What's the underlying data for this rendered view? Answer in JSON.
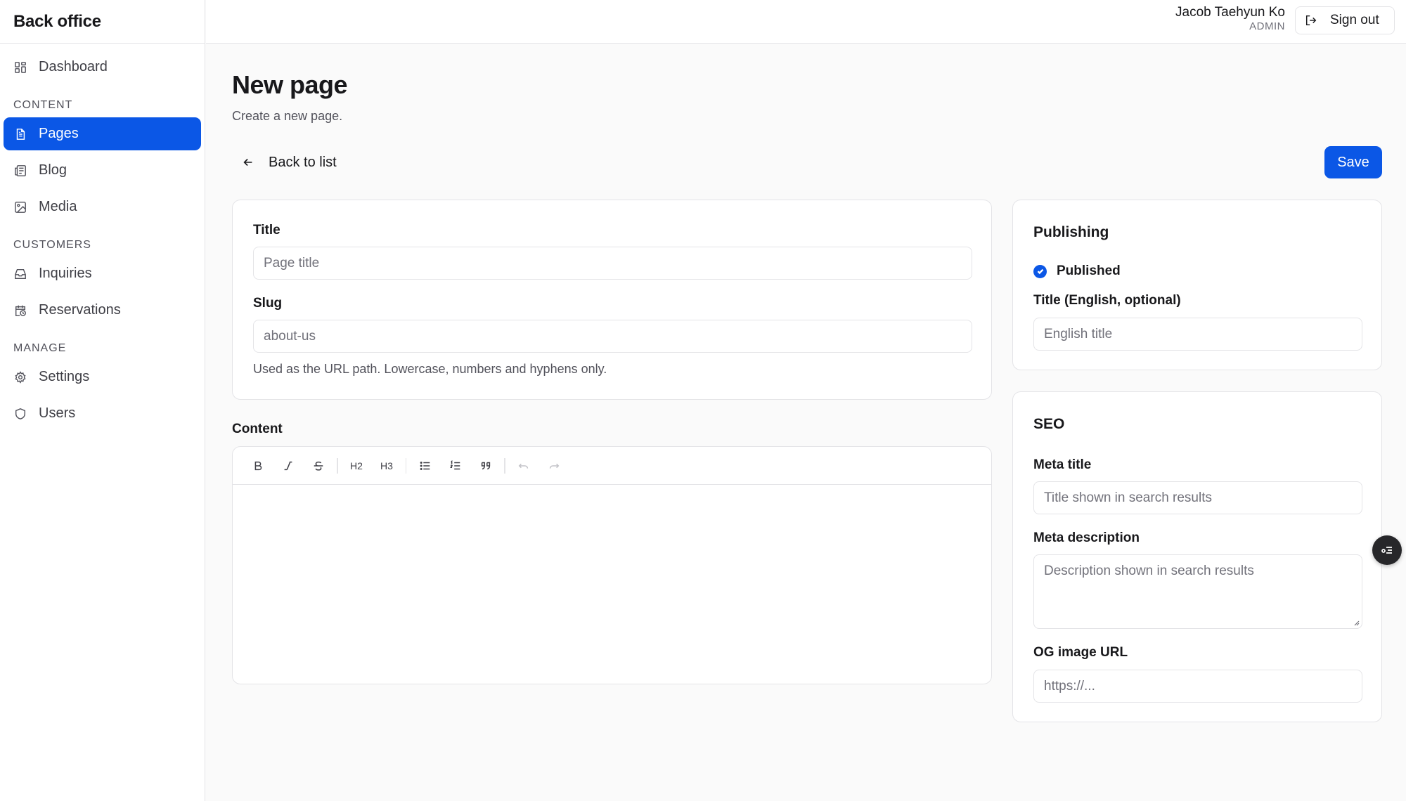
{
  "app": {
    "brand": "Back office"
  },
  "sidebar": {
    "dashboard": "Dashboard",
    "sections": {
      "content": "CONTENT",
      "customers": "CUSTOMERS",
      "manage": "MANAGE"
    },
    "items": {
      "pages": "Pages",
      "blog": "Blog",
      "media": "Media",
      "inquiries": "Inquiries",
      "reservations": "Reservations",
      "settings": "Settings",
      "users": "Users"
    },
    "active": "pages"
  },
  "header": {
    "user_name": "Jacob Taehyun Ko",
    "user_role": "ADMIN",
    "signout_label": "Sign out"
  },
  "page": {
    "title": "New page",
    "subtitle": "Create a new page.",
    "back_label": "Back to list",
    "save_label": "Save"
  },
  "form": {
    "title_label": "Title",
    "title_placeholder": "Page title",
    "slug_label": "Slug",
    "slug_value": "about-us",
    "slug_hint": "Used as the URL path. Lowercase, numbers and hyphens only.",
    "content_label": "Content",
    "toolbar": {
      "h2": "H2",
      "h3": "H3"
    }
  },
  "publishing": {
    "heading": "Publishing",
    "published_label": "Published",
    "published_checked": true,
    "title_en_label": "Title (English, optional)",
    "title_en_placeholder": "English title"
  },
  "seo": {
    "heading": "SEO",
    "meta_title_label": "Meta title",
    "meta_title_placeholder": "Title shown in search results",
    "meta_desc_label": "Meta description",
    "meta_desc_placeholder": "Description shown in search results",
    "og_label": "OG image URL",
    "og_placeholder": "https://..."
  },
  "colors": {
    "accent": "#0b57e6",
    "border": "#e4e4e7",
    "background": "#fafafa"
  }
}
